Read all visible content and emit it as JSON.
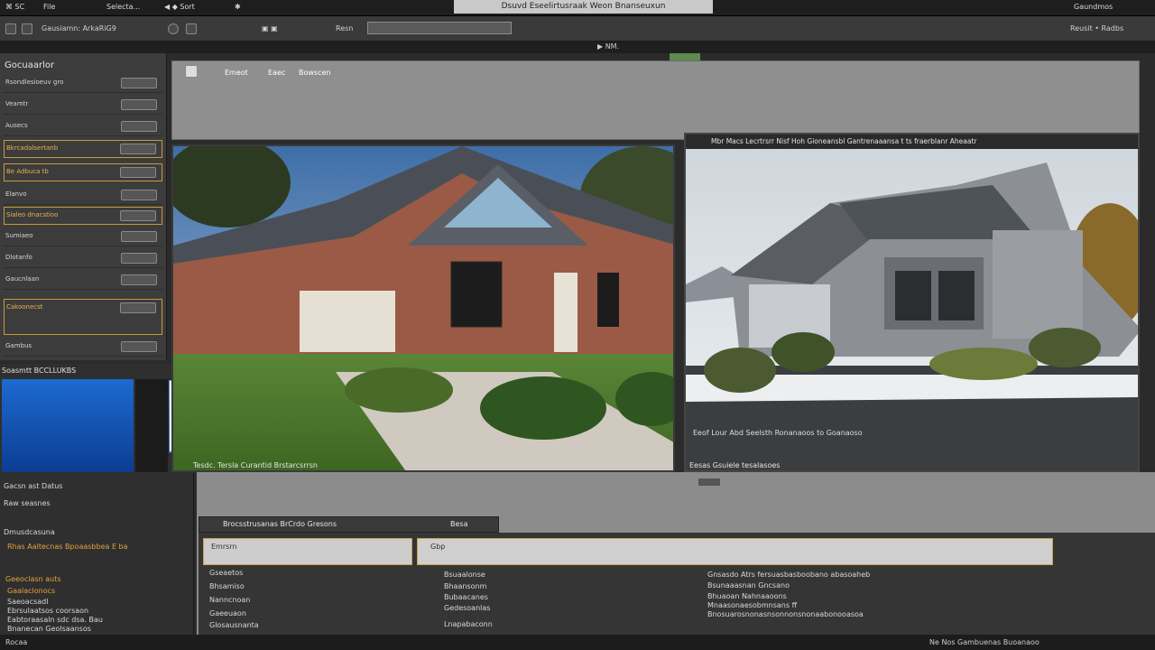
{
  "menubar": {
    "items": [
      "⌘ SC",
      "File",
      "Selecta...",
      "◀ ◆ Sort",
      "✱"
    ],
    "title": "Dsuvd Eseelirtusraak Weon Bnanseuxun",
    "right_text": "Gaundmos"
  },
  "toolbar": {
    "left_label": "Gausiamn: ArkaRiG9",
    "mid1": "▣ ▣",
    "mid2": "Resn",
    "search_value": "",
    "right_label": "Reusit • Radbs"
  },
  "bar2": {
    "label": "▶ NM."
  },
  "left_panel": {
    "title": "Gocuaarlor",
    "rows": [
      {
        "label": "Rsondlesioeuv gro"
      },
      {
        "label": "Veamtr"
      },
      {
        "label": "Ausecs"
      },
      {
        "label": "Bkrcadalsertanb",
        "highlight": true
      },
      {
        "label": "Be Adbuca tb"
      },
      {
        "label": "Elanvo"
      },
      {
        "label": "Sialeo dnacstioo"
      },
      {
        "label": "Sumiaeo"
      },
      {
        "label": "Dlotanfo"
      },
      {
        "label": "Gaucnlaan"
      },
      {
        "label": "Cakoonecst"
      },
      {
        "label": "Gambus"
      }
    ]
  },
  "left_bottom": {
    "header": "Soasmtt BCCLLUKBS",
    "items": [
      {
        "label": "Gacsn ast Datus",
        "orange": false
      },
      {
        "label": "Raw seasnes",
        "orange": false
      },
      {
        "label": "Dmusdcasuna",
        "orange": false
      },
      {
        "label": "Rhas Aaltecnas Bpoaasbbea E ba",
        "orange": true
      },
      {
        "label": "Geeoclasn auts",
        "orange": true
      },
      {
        "label": "Gaalaclonocs",
        "orange": true
      },
      {
        "label": "Saeoacsadl",
        "orange": false
      },
      {
        "label": "Ebrsulaatsos coorsaon",
        "orange": false
      },
      {
        "label": "Eabtoraasaln sdc dsa. Bau",
        "orange": false
      },
      {
        "label": "Bnanecan Geolsaansos",
        "orange": false
      }
    ]
  },
  "center": {
    "top_labels": [
      "Emeot",
      "Eaec",
      "Bowscen"
    ],
    "viewport_left_caption": "Tesdc. Tersla Curantid Brstarcsrrsn",
    "viewport_right_header": "Mbr Macs Lecrtrsrr Nisf Hoh Gioneansbl Gantrenaaansa t ts fraerblanr Aheaatr",
    "viewport_right_caption": "Eeof Lour Abd Seelsth Ronanaoos to Goanaoso",
    "viewport_right_footer": "Eesas Gsuiele tesalasoes"
  },
  "lower": {
    "tab_label": "Brocsstrusanas BrCrdo Gresons",
    "tab_right": "Besa",
    "field_a_value": "Emrsrn",
    "field_b_value": "Gbp",
    "list_left": [
      "Gseaetos",
      "Bhsamiso",
      "Nanncnoan",
      "Gaeeuaon",
      "Glosausnanta"
    ],
    "list_mid": [
      "Bsuaalonse",
      "Bhaansonm",
      "Bubaacanes",
      "Gedesoanlas",
      "Lnapabaconn"
    ],
    "list_right": [
      "Gnsasdo Atrs fersuasbasboobano abasoaheb",
      "Bsunaaasnan Gncsano",
      "Bhuaoan Nahnaaoons",
      "Mnaasonaesobmnsans ff",
      "Bnosuarosnonasnsonnonsnonaabonooasoa"
    ]
  },
  "statusbar": {
    "left": "Rocaa",
    "right": "Ne Nos Gambuenas Buoanaoo"
  }
}
